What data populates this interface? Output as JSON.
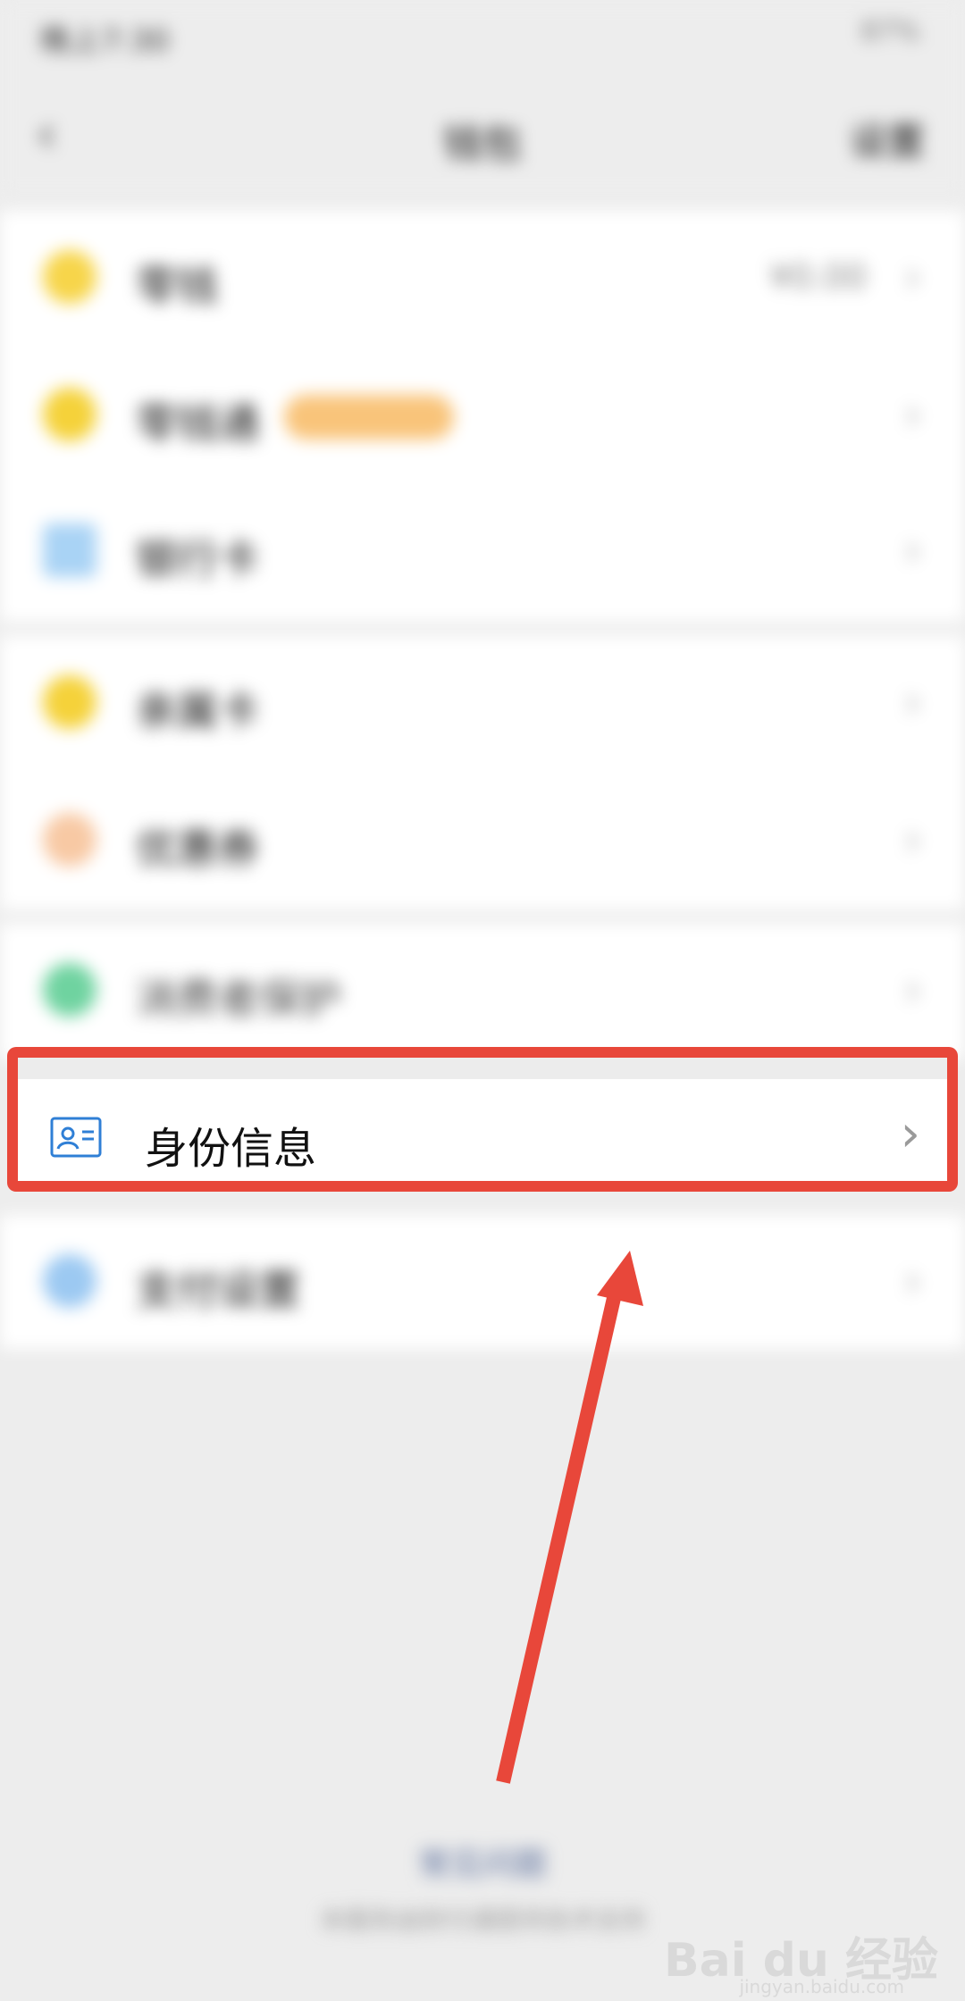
{
  "status": {
    "time": "晚上7:30",
    "right": "87%"
  },
  "nav": {
    "title": "钱包",
    "right": "设置"
  },
  "wallet_rows": [
    {
      "label": "零钱",
      "value": "¥0.00",
      "color": "#f7d54a"
    },
    {
      "label": "零钱通",
      "color": "#f5d23a"
    },
    {
      "label": "银行卡",
      "color": "#a9d3f5"
    }
  ],
  "service_rows": [
    {
      "label": "亲属卡",
      "color": "#f5d23a"
    },
    {
      "label": "优惠券",
      "color": "#f8c9a4"
    }
  ],
  "consumer_row": {
    "label": "消费者保护",
    "color": "#6fd3a0"
  },
  "identity_row": {
    "label": "身份信息"
  },
  "payment_row": {
    "label": "支付设置",
    "color": "#9cc9f2"
  },
  "footer": {
    "link": "常见问题",
    "note": "本服务由财付通提供技术支持"
  },
  "watermark": {
    "brand": "Bai du 经验",
    "url": "jingyan.baidu.com"
  },
  "colors": {
    "highlight": "#e8473a",
    "idcard_blue": "#2f7fd6"
  }
}
